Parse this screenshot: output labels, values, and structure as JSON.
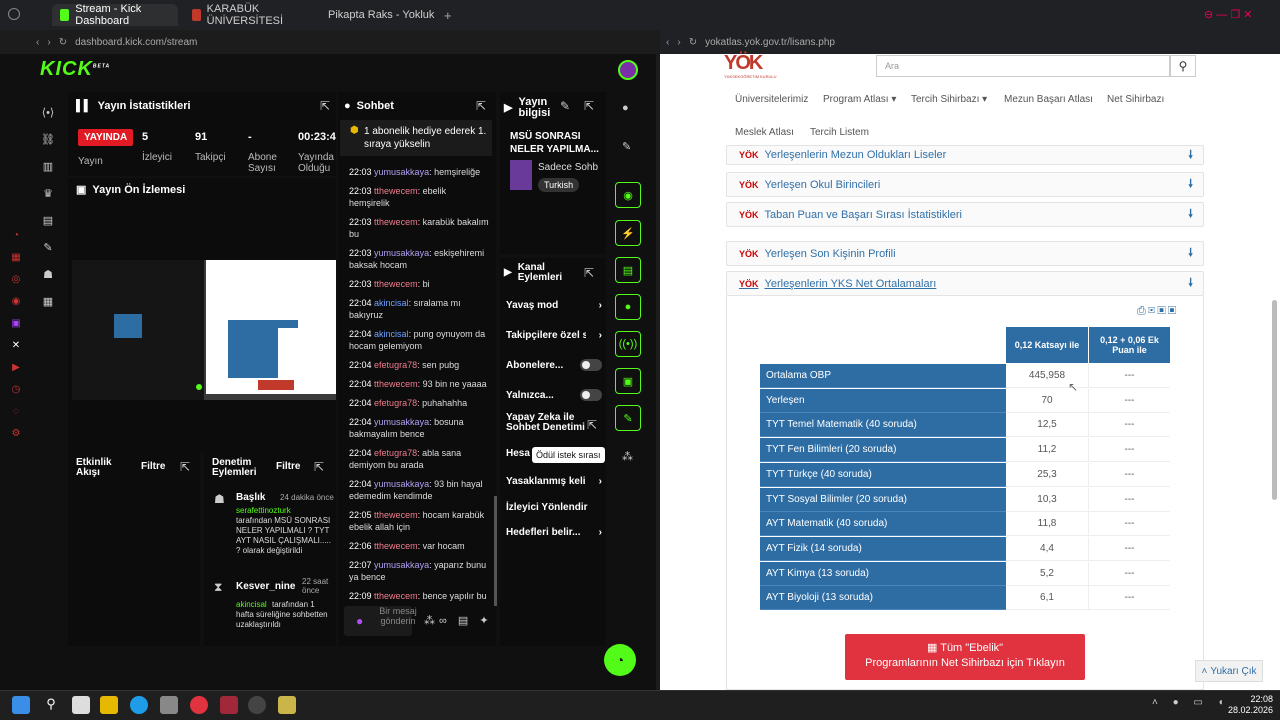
{
  "tabs": [
    {
      "label": "Stream - Kick Dashboard",
      "color": "#53fc18"
    },
    {
      "label": "KARABÜK ÜNİVERSİTESİ",
      "color": "#c0392b"
    },
    {
      "label": "Pikapta Raks - Yokluk",
      "color": "#ff0000"
    }
  ],
  "left_url": "dashboard.kick.com/stream",
  "right_url": "yokatlas.yok.gov.tr/lisans.php",
  "kick": {
    "logo": "KICK",
    "logo_sup": "BETA",
    "stats": {
      "title": "Yayın İstatistikleri",
      "badge": "YAYINDA",
      "badge_lbl": "Yayın",
      "viewers": "5",
      "viewers_lbl": "İzleyici",
      "followers": "91",
      "followers_lbl": "Takipçi",
      "subs": "-",
      "subs_lbl": "Abone Sayısı",
      "time": "00:23:4",
      "time_lbl": "Yayında Olduğu"
    },
    "preview_title": "Yayın Ön İzlemesi",
    "activity": {
      "title": "Etkinlik Akışı",
      "filter": "Filtre"
    },
    "mod": {
      "title": "Denetim Eylemleri",
      "filter": "Filtre",
      "item1_title": "Başlık",
      "item1_time": "24 dakika önce",
      "item1_user": "serafettinozturk",
      "item1_text": "tarafından MSÜ SONRASI NELER YAPILMALI ? TYT AYT NASIL ÇALIŞMALI..... ? olarak değiştirildi",
      "item2_title": "Kesver_nine",
      "item2_time": "22 saat önce",
      "item2_user": "akincisal",
      "item2_text": "tarafından 1 hafta süreliğine sohbetten uzaklaştırıldı"
    },
    "chat": {
      "title": "Sohbet",
      "pinned": "1 abonelik hediye ederek 1. sıraya yükselin",
      "input_placeholder": "Bir mesaj gönderin",
      "lines": [
        {
          "time": "22:03",
          "user": "yumusakkaya",
          "cls": "u1",
          "msg": "hemşireliğe"
        },
        {
          "time": "22:03",
          "user": "tthewecem",
          "cls": "u2",
          "msg": "ebelik hemşirelik"
        },
        {
          "time": "22:03",
          "user": "tthewecem",
          "cls": "u2",
          "msg": "karabük bakalım bu"
        },
        {
          "time": "22:03",
          "user": "yumusakkaya",
          "cls": "u1",
          "msg": "eskişehiremi baksak hocam"
        },
        {
          "time": "22:03",
          "user": "tthewecem",
          "cls": "u2",
          "msg": "bi"
        },
        {
          "time": "22:04",
          "user": "akincisal",
          "cls": "u3",
          "msg": "sıralama mı bakıyruz"
        },
        {
          "time": "22:04",
          "user": "akincisal",
          "cls": "u3",
          "msg": "pung oynuyom da hocam gelemiyom"
        },
        {
          "time": "22:04",
          "user": "efetugra78",
          "cls": "u2",
          "msg": "sen pubg"
        },
        {
          "time": "22:04",
          "user": "tthewecem",
          "cls": "u2",
          "msg": "93 bin ne yaaaa"
        },
        {
          "time": "22:04",
          "user": "efetugra78",
          "cls": "u2",
          "msg": "puhahahha"
        },
        {
          "time": "22:04",
          "user": "yumusakkaya",
          "cls": "u1",
          "msg": "bosuna bakmayalım bence"
        },
        {
          "time": "22:04",
          "user": "efetugra78",
          "cls": "u2",
          "msg": "abla sana demiyom bu arada"
        },
        {
          "time": "22:04",
          "user": "yumusakkaya",
          "cls": "u1",
          "msg": "93 bin hayal edemedim kendimde"
        },
        {
          "time": "22:05",
          "user": "tthewecem",
          "cls": "u2",
          "msg": "hocam karabük ebelik allah için"
        },
        {
          "time": "22:06",
          "user": "tthewecem",
          "cls": "u2",
          "msg": "var hocam"
        },
        {
          "time": "22:07",
          "user": "yumusakkaya",
          "cls": "u1",
          "msg": "yaparız bunu ya bence"
        },
        {
          "time": "22:09",
          "user": "tthewecem",
          "cls": "u2",
          "msg": "bence yapılır bu"
        }
      ]
    },
    "info": {
      "title": "Yayın bilgisi",
      "stream_title": "MSÜ SONRASI NELER YAPILMA...",
      "category": "Sadece Sohb",
      "lang": "Turkish"
    },
    "channel": {
      "title": "Kanal Eylemleri",
      "items": [
        "Yavaş mod",
        "Takipçilere özel s",
        "Abonelere...",
        "Yalnızca...",
        "Yapay Zeka ile Sohbet Denetimi",
        "Hesa",
        "Yasaklanmış keli",
        "İzleyici Yönlendir",
        "Hedefleri belir..."
      ],
      "tooltip": "Ödül istek sırası"
    }
  },
  "yok": {
    "search_placeholder": "Ara",
    "logo_text": "YÜKSEKÖĞRETİM KURULU",
    "nav": [
      "Üniversitelerimiz",
      "Program Atlası",
      "Tercih Sihirbazı",
      "Mezun Başarı Atlası",
      "Net Sihirbazı",
      "Meslek Atlası",
      "Tercih Listem"
    ],
    "accordions": [
      "Yerleşenlerin Mezun Oldukları Liseler",
      "Yerleşen Okul Birincileri",
      "Taban Puan ve Başarı Sırası İstatistikleri",
      "Yerleşen Son Kişinin Profili",
      "Yerleşenlerin YKS Net Ortalamaları"
    ],
    "col1": "0,12 Katsayı ile",
    "col2": "0,12 + 0,06 Ek Puan ile",
    "rows": [
      {
        "label": "Ortalama OBP",
        "v1": "445,958",
        "v2": "---"
      },
      {
        "label": "Yerleşen",
        "v1": "70",
        "v2": "---"
      },
      {
        "label": "TYT Temel Matematik (40 soruda)",
        "v1": "12,5",
        "v2": "---"
      },
      {
        "label": "TYT Fen Bilimleri (20 soruda)",
        "v1": "11,2",
        "v2": "---"
      },
      {
        "label": "TYT Türkçe (40 soruda)",
        "v1": "25,3",
        "v2": "---"
      },
      {
        "label": "TYT Sosyal Bilimler (20 soruda)",
        "v1": "10,3",
        "v2": "---"
      },
      {
        "label": "AYT Matematik (40 soruda)",
        "v1": "11,8",
        "v2": "---"
      },
      {
        "label": "AYT Fizik (14 soruda)",
        "v1": "4,4",
        "v2": "---"
      },
      {
        "label": "AYT Kimya (13 soruda)",
        "v1": "5,2",
        "v2": "---"
      },
      {
        "label": "AYT Biyoloji (13 soruda)",
        "v1": "6,1",
        "v2": "---"
      }
    ],
    "red_btn_l1": "Tüm \"Ebelik\"",
    "red_btn_l2": "Programlarının Net Sihirbazı için Tıklayın",
    "up_btn": "Yukarı Çık"
  },
  "clock": {
    "time": "22:08",
    "date": "28.02.2026"
  }
}
